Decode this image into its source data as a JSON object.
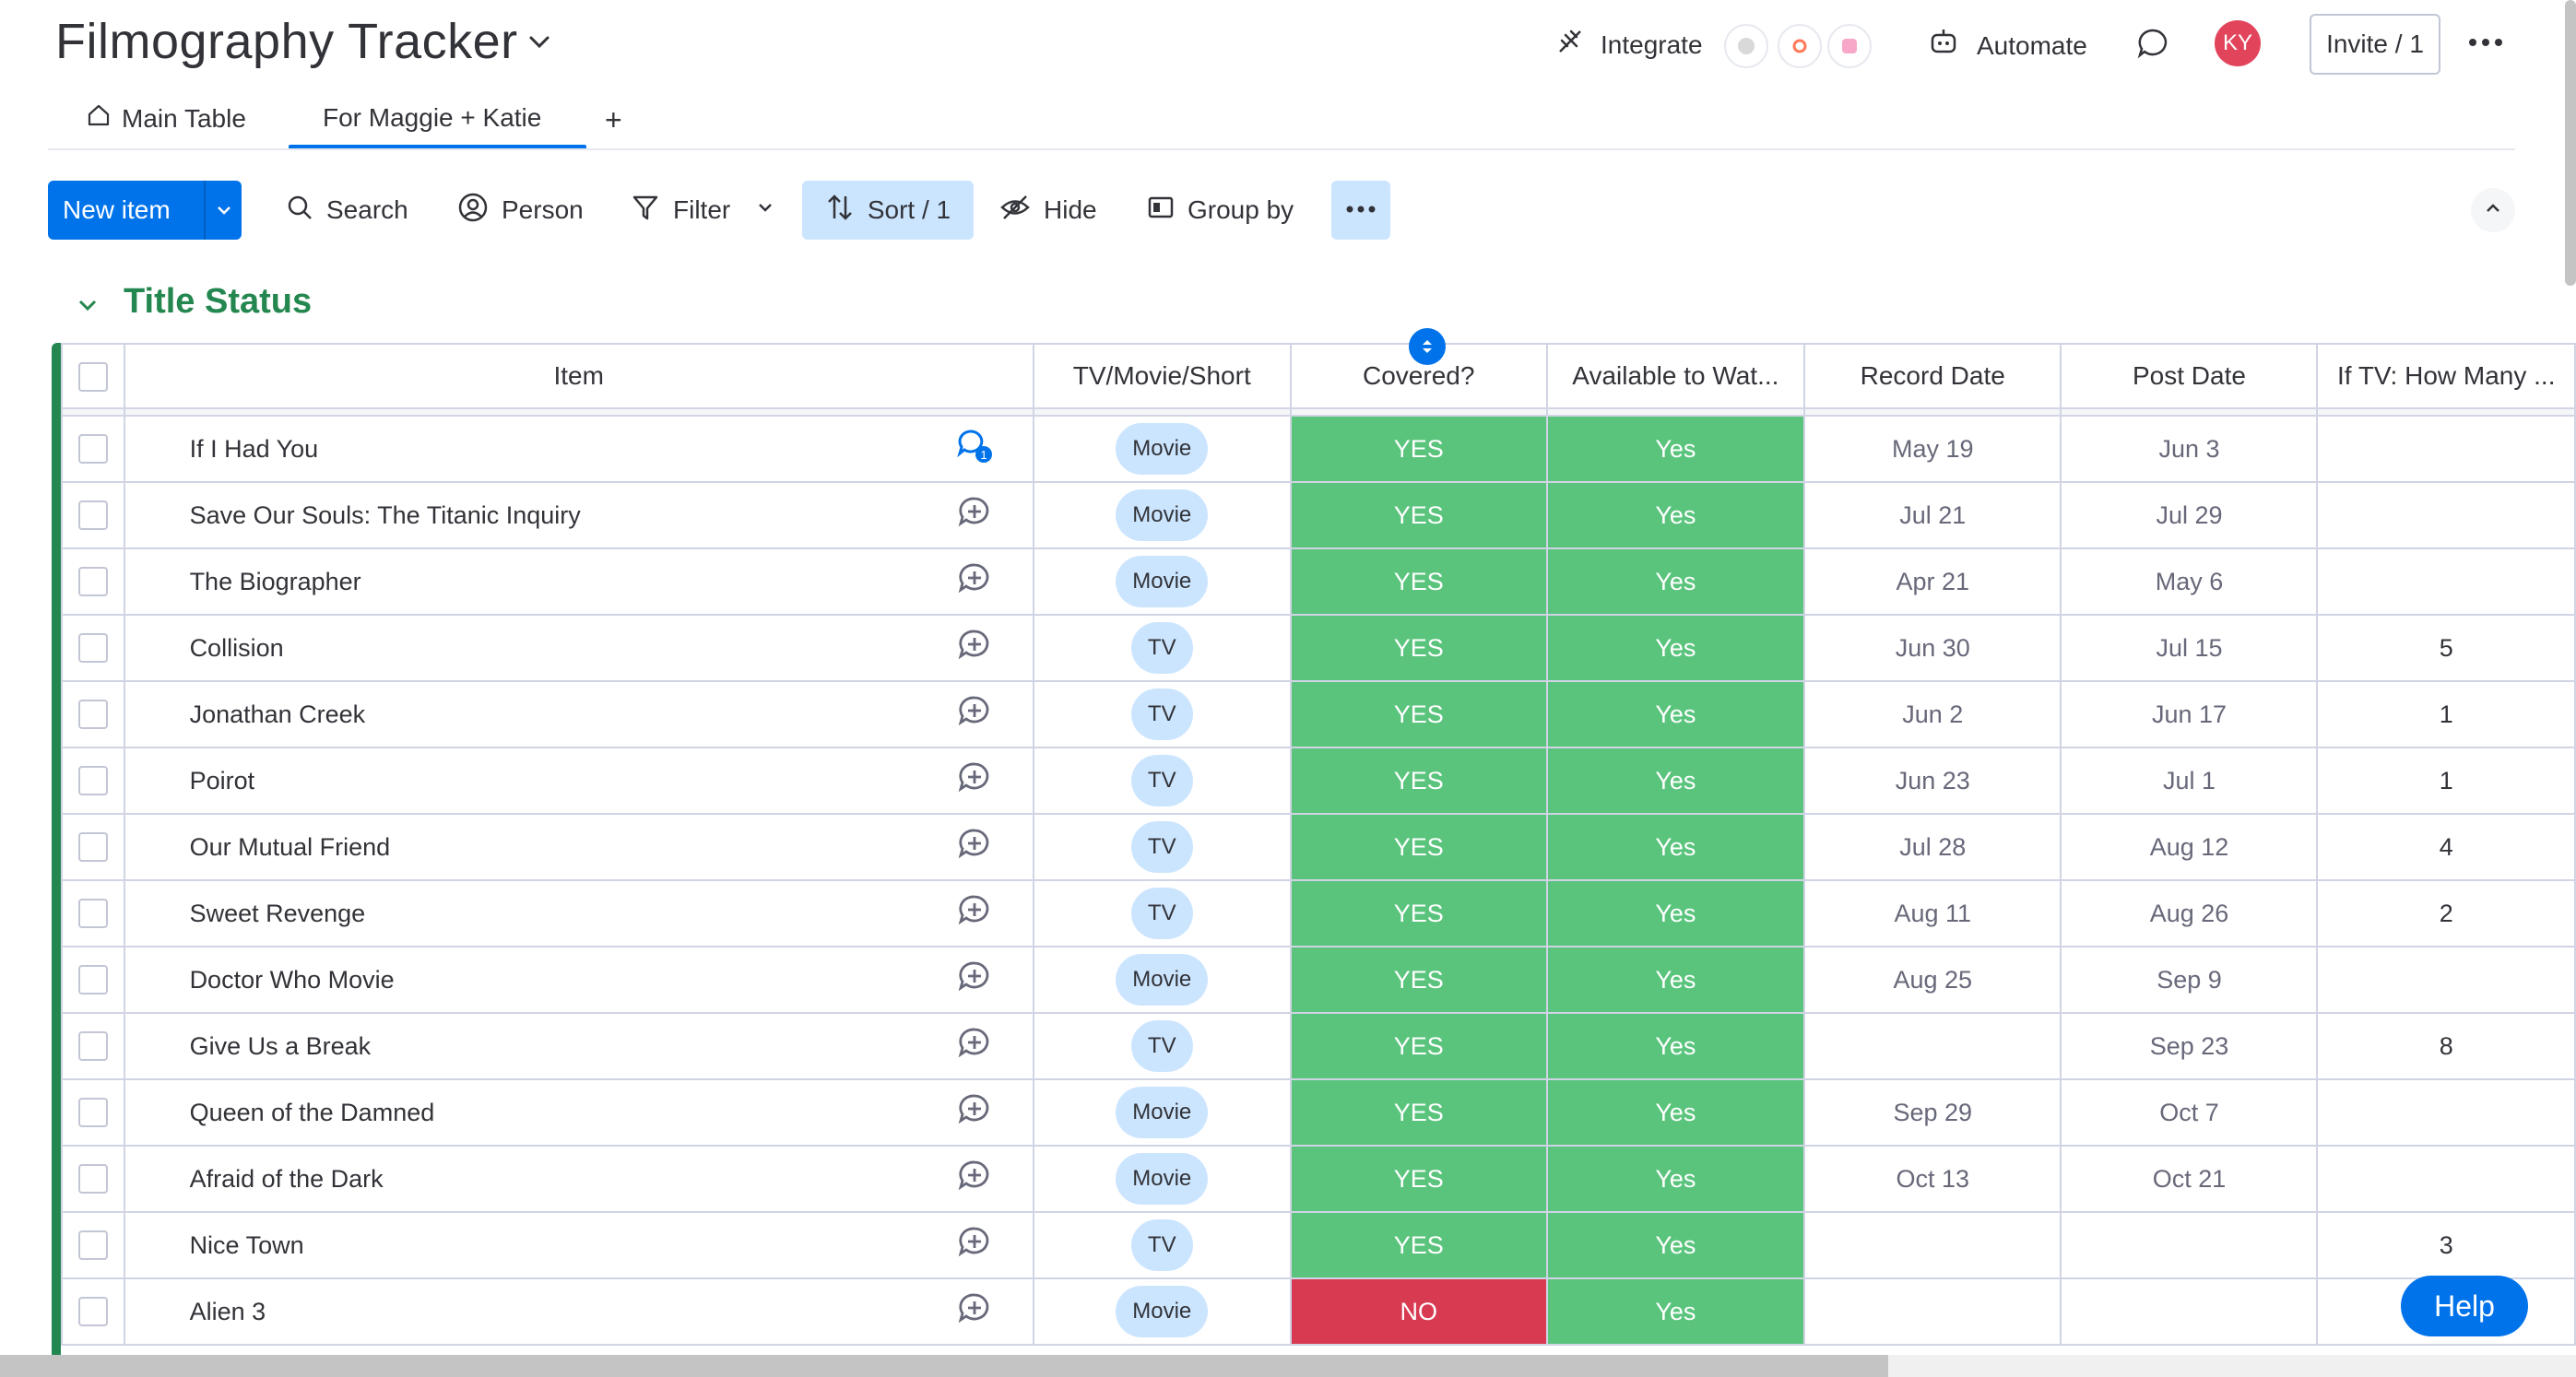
{
  "board": {
    "title": "Filmography Tracker"
  },
  "header": {
    "integrate_label": "Integrate",
    "automate_label": "Automate",
    "avatar_initials": "KY",
    "invite_label": "Invite / 1"
  },
  "tabs": [
    {
      "label": "Main Table",
      "icon": "home-icon"
    },
    {
      "label": "For Maggie + Katie"
    }
  ],
  "toolbar": {
    "new_item_label": "New item",
    "search_label": "Search",
    "person_label": "Person",
    "filter_label": "Filter",
    "sort_label": "Sort / 1",
    "hide_label": "Hide",
    "group_by_label": "Group by"
  },
  "group": {
    "title": "Title Status",
    "color": "#258750"
  },
  "columns": [
    "Item",
    "TV/Movie/Short",
    "Covered?",
    "Available to Wat...",
    "Record Date",
    "Post Date",
    "If TV: How Many ..."
  ],
  "rows": [
    {
      "name": "If I Had You",
      "type": "Movie",
      "covered": "YES",
      "available": "Yes",
      "record": "May 19",
      "post": "Jun 3",
      "count": "",
      "updates": "1"
    },
    {
      "name": "Save Our Souls: The Titanic Inquiry",
      "type": "Movie",
      "covered": "YES",
      "available": "Yes",
      "record": "Jul 21",
      "post": "Jul 29",
      "count": ""
    },
    {
      "name": "The Biographer",
      "type": "Movie",
      "covered": "YES",
      "available": "Yes",
      "record": "Apr 21",
      "post": "May 6",
      "count": ""
    },
    {
      "name": "Collision",
      "type": "TV",
      "covered": "YES",
      "available": "Yes",
      "record": "Jun 30",
      "post": "Jul 15",
      "count": "5"
    },
    {
      "name": "Jonathan Creek",
      "type": "TV",
      "covered": "YES",
      "available": "Yes",
      "record": "Jun 2",
      "post": "Jun 17",
      "count": "1"
    },
    {
      "name": "Poirot",
      "type": "TV",
      "covered": "YES",
      "available": "Yes",
      "record": "Jun 23",
      "post": "Jul 1",
      "count": "1"
    },
    {
      "name": "Our Mutual Friend",
      "type": "TV",
      "covered": "YES",
      "available": "Yes",
      "record": "Jul 28",
      "post": "Aug 12",
      "count": "4"
    },
    {
      "name": "Sweet Revenge",
      "type": "TV",
      "covered": "YES",
      "available": "Yes",
      "record": "Aug 11",
      "post": "Aug 26",
      "count": "2"
    },
    {
      "name": "Doctor Who Movie",
      "type": "Movie",
      "covered": "YES",
      "available": "Yes",
      "record": "Aug 25",
      "post": "Sep 9",
      "count": ""
    },
    {
      "name": "Give Us a Break",
      "type": "TV",
      "covered": "YES",
      "available": "Yes",
      "record": "",
      "post": "Sep 23",
      "count": "8"
    },
    {
      "name": "Queen of the Damned",
      "type": "Movie",
      "covered": "YES",
      "available": "Yes",
      "record": "Sep 29",
      "post": "Oct 7",
      "count": ""
    },
    {
      "name": "Afraid of the Dark",
      "type": "Movie",
      "covered": "YES",
      "available": "Yes",
      "record": "Oct 13",
      "post": "Oct 21",
      "count": ""
    },
    {
      "name": "Nice Town",
      "type": "TV",
      "covered": "YES",
      "available": "Yes",
      "record": "",
      "post": "",
      "count": "3"
    },
    {
      "name": "Alien 3",
      "type": "Movie",
      "covered": "NO",
      "available": "Yes",
      "record": "",
      "post": "",
      "count": ""
    }
  ],
  "status_colors": {
    "yes": "#5ac47d",
    "no": "#d83a52",
    "accent": "#0073ea"
  },
  "help": {
    "label": "Help"
  }
}
